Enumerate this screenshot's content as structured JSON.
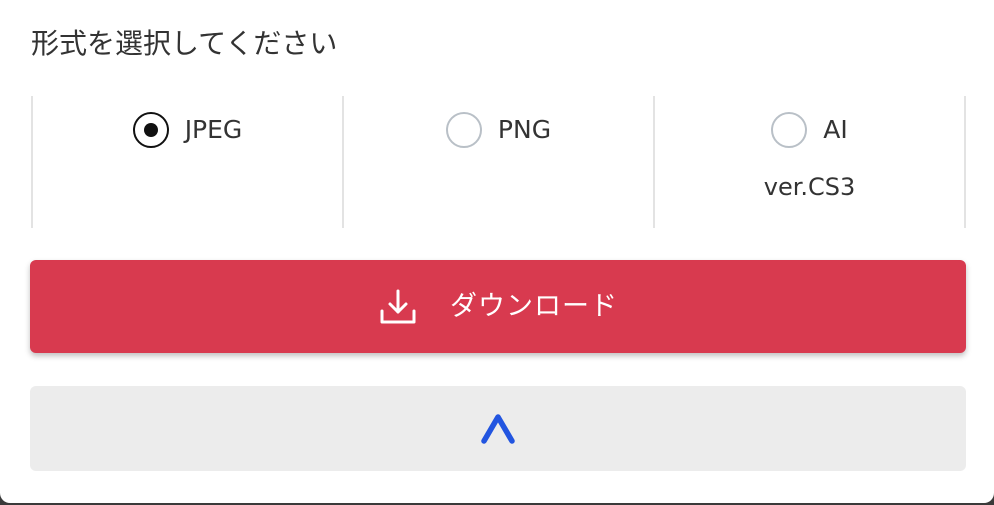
{
  "title": "形式を選択してください",
  "formats": [
    {
      "label": "JPEG",
      "sub": "",
      "selected": true
    },
    {
      "label": "PNG",
      "sub": "",
      "selected": false
    },
    {
      "label": "AI",
      "sub": "ver.CS3",
      "selected": false
    }
  ],
  "download": {
    "label": "ダウンロード",
    "icon": "download-icon"
  },
  "collapse": {
    "icon": "chevron-up-icon"
  },
  "colors": {
    "accent_red": "#d83a4f",
    "chevron_blue": "#2255e0",
    "radio_unchecked": "#b9c0c7"
  }
}
